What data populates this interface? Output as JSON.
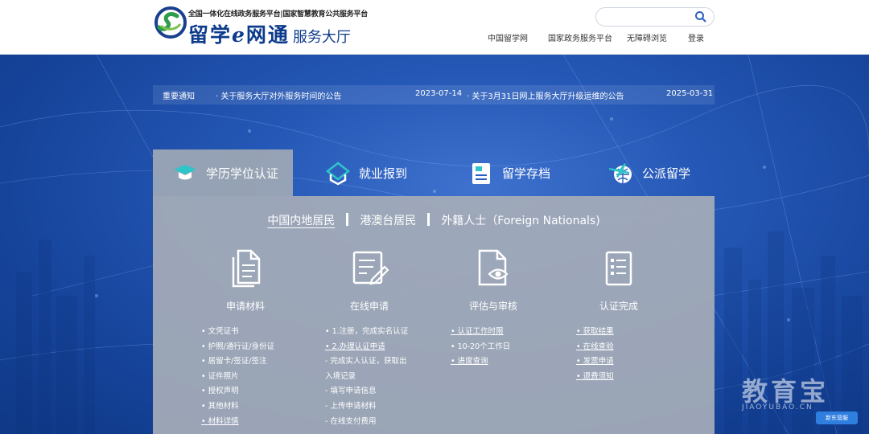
{
  "header": {
    "subtitle": "全国一体化在线政务服务平台|国家智慧教育公共服务平台",
    "brand_main": "留学",
    "brand_e": "e",
    "brand_main2": "网通",
    "brand_sub": "服务大厅",
    "search": {
      "placeholder": ""
    },
    "nav": [
      "中国留学网",
      "国家政务服务平台",
      "无障碍浏览",
      "登录"
    ]
  },
  "notices": {
    "label": "重要通知",
    "items": [
      {
        "title": "· 关于服务大厅对外服务时间的公告",
        "date": "2023-07-14"
      },
      {
        "title": "· 关于3月31日网上服务大厅升级运维的公告",
        "date": "2025-03-31"
      }
    ]
  },
  "tabs": [
    {
      "label": "学历学位认证",
      "icon": "graduation-cap-icon",
      "active": true
    },
    {
      "label": "就业报到",
      "icon": "building-icon",
      "active": false
    },
    {
      "label": "留学存档",
      "icon": "archive-icon",
      "active": false
    },
    {
      "label": "公派留学",
      "icon": "airplane-globe-icon",
      "active": false
    }
  ],
  "subtabs": [
    "中国内地居民",
    "港澳台居民",
    "外籍人士（Foreign Nationals)"
  ],
  "steps": [
    {
      "label": "申请材料",
      "icon": "documents-icon"
    },
    {
      "label": "在线申请",
      "icon": "edit-form-icon"
    },
    {
      "label": "评估与审核",
      "icon": "review-eye-icon"
    },
    {
      "label": "认证完成",
      "icon": "checklist-icon"
    }
  ],
  "columns": [
    [
      "• 文凭证书",
      "• 护照/通行证/身份证",
      "• 居留卡/签证/签注",
      "• 证件照片",
      "• 授权声明",
      "• 其他材料",
      "• 材料详情"
    ],
    [
      "• 1.注册，完成实名认证",
      "• 2.办理认证申请",
      "  - 完成实人认证，获取出",
      "  入境记录",
      "  - 填写申请信息",
      "  - 上传申请材料",
      "  - 在线支付费用"
    ],
    [
      "• 认证工作时限",
      "• 10-20个工作日",
      "• 进度查询"
    ],
    [
      "• 获取结果",
      "• 在线查验",
      "• 发票申请",
      "• 退费须知"
    ]
  ],
  "watermark": {
    "text": "教育宝",
    "sub": "JIAOYUBAO.CN"
  },
  "help_button": "新东营服"
}
